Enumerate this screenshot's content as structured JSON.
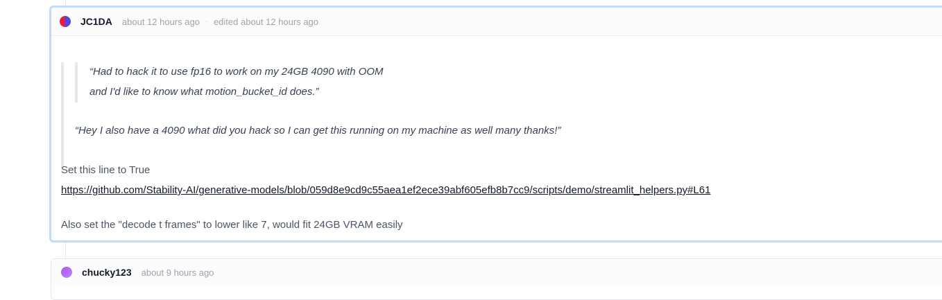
{
  "comments": [
    {
      "author": "JC1DA",
      "time": "about 12 hours ago",
      "separator": "·",
      "edited": "edited about 12 hours ago",
      "nested_quote": [
        "“Had to hack it to use fp16 to work on my 24GB 4090 with OOM",
        "and I'd like to know what motion_bucket_id does.”"
      ],
      "quote": "“Hey I also have a 4090 what did you hack so I can get this running on my machine as well many thanks!”",
      "line1": "Set this line to True",
      "link": "https://github.com/Stability-AI/generative-models/blob/059d8e9cd9c55aea1ef2ece39abf605efb8b7cc9/scripts/demo/streamlit_helpers.py#L61",
      "line2": "Also set the \"decode t frames\" to lower like 7, would fit 24GB VRAM easily"
    },
    {
      "author": "chucky123",
      "time": "about 9 hours ago"
    }
  ]
}
